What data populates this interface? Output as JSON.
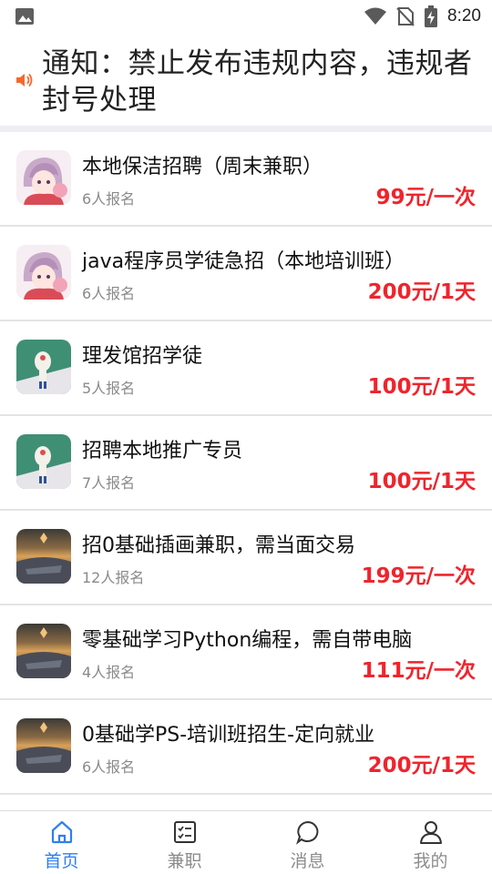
{
  "status_bar": {
    "time": "8:20",
    "icons": [
      "image-icon",
      "wifi-icon",
      "no-sim-icon",
      "battery-charging-icon"
    ]
  },
  "notice": {
    "icon": "speaker-icon",
    "text": "通知：禁止发布违规内容，违规者封号处理"
  },
  "jobs": [
    {
      "title": "本地保洁招聘（周末兼职）",
      "applicants": "6人报名",
      "salary": "99元/一次",
      "avatar": "anime-avatar"
    },
    {
      "title": "java程序员学徒急招（本地培训班）",
      "applicants": "6人报名",
      "salary": "200元/1天",
      "avatar": "anime-avatar"
    },
    {
      "title": "理发馆招学徒",
      "applicants": "5人报名",
      "salary": "100元/1天",
      "avatar": "character-avatar"
    },
    {
      "title": "招聘本地推广专员",
      "applicants": "7人报名",
      "salary": "100元/1天",
      "avatar": "character-avatar"
    },
    {
      "title": "招0基础插画兼职，需当面交易",
      "applicants": "12人报名",
      "salary": "199元/一次",
      "avatar": "sunset-avatar"
    },
    {
      "title": "零基础学习Python编程，需自带电脑",
      "applicants": "4人报名",
      "salary": "111元/一次",
      "avatar": "sunset-avatar"
    },
    {
      "title": "0基础学PS-培训班招生-定向就业",
      "applicants": "6人报名",
      "salary": "200元/1天",
      "avatar": "sunset-avatar"
    }
  ],
  "tabs": [
    {
      "label": "首页",
      "icon": "home-icon",
      "active": true
    },
    {
      "label": "兼职",
      "icon": "checklist-icon",
      "active": false
    },
    {
      "label": "消息",
      "icon": "chat-bubble-icon",
      "active": false
    },
    {
      "label": "我的",
      "icon": "user-icon",
      "active": false
    }
  ],
  "colors": {
    "accent": "#2f7ff0",
    "salary": "#f0242c",
    "speaker": "#f26a2e"
  }
}
